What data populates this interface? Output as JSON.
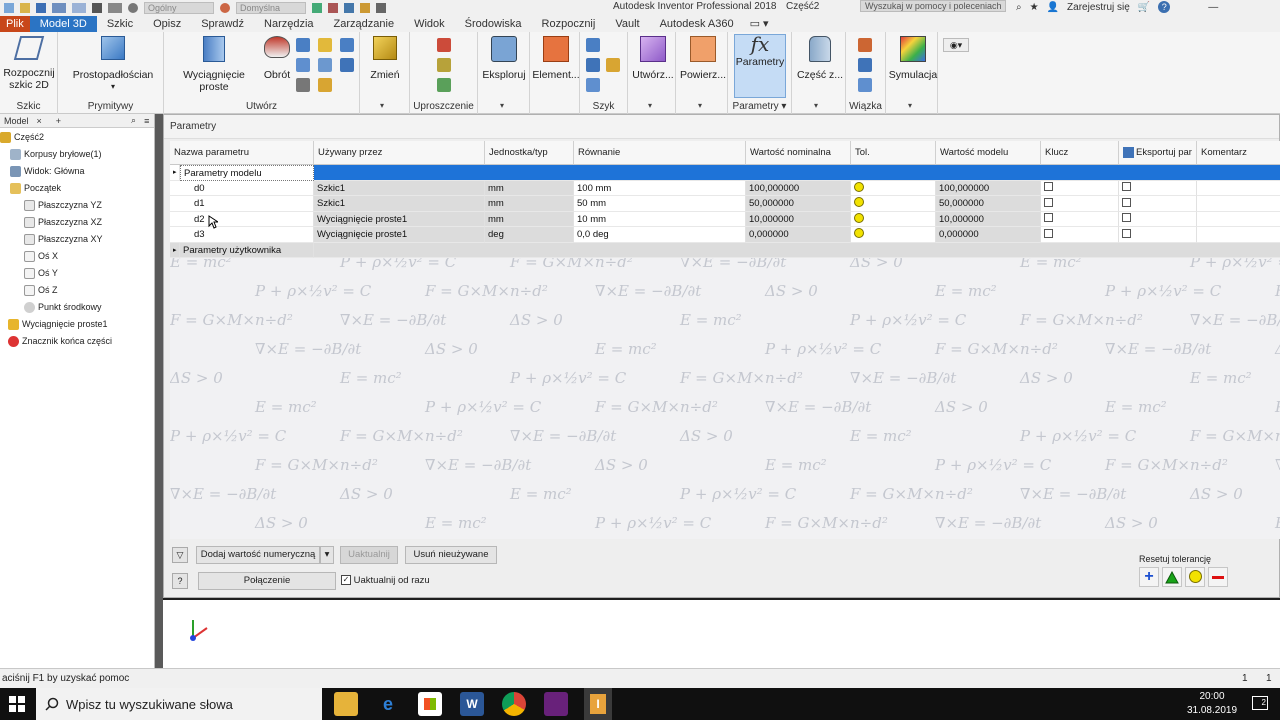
{
  "titlebar": {
    "dropdown1": "Ogólny",
    "dropdown2": "Domyślna",
    "app_title": "Autodesk Inventor Professional 2018",
    "doc_title": "Część2",
    "help_search": "Wyszukaj w pomocy i poleceniach",
    "signin": "Zarejestruj się"
  },
  "tabs": [
    "Plik",
    "Model 3D",
    "Szkic",
    "Opisz",
    "Sprawdź",
    "Narzędzia",
    "Zarządzanie",
    "Widok",
    "Środowiska",
    "Rozpocznij",
    "Vault",
    "Autodesk A360"
  ],
  "ribbon": {
    "sketch_btn": "Rozpocznij",
    "sketch_btn2": "szkic 2D",
    "panel_sketch": "Szkic",
    "box_btn": "Prostopadłościan",
    "panel_primitives": "Prymitywy",
    "extrude_btn": "Wyciągnięcie proste",
    "revolve_btn": "Obrót",
    "panel_create": "Utwórz",
    "modify_btn": "Zmień",
    "panel_simplify": "Uproszczenie",
    "explore_btn": "Eksploruj",
    "element_btn": "Element...",
    "panel_pattern": "Szyk",
    "create_btn": "Utwórz...",
    "surface_btn": "Powierz...",
    "params_btn": "Parametry",
    "panel_params": "Parametry",
    "part_btn": "Część z...",
    "panel_harness": "Wiązka",
    "sim_btn": "Symulacja"
  },
  "browser": {
    "tab_label": "Model",
    "items": [
      "Część2",
      "Korpusy bryłowe(1)",
      "Widok: Główna",
      "Początek",
      "Płaszczyzna YZ",
      "Płaszczyzna XZ",
      "Płaszczyzna XY",
      "Oś X",
      "Oś Y",
      "Oś Z",
      "Punkt środkowy",
      "Wyciągnięcie proste1",
      "Znacznik końca części"
    ]
  },
  "dialog": {
    "title": "Parametry",
    "columns": [
      "Nazwa parametru",
      "Używany przez",
      "Jednostka/typ",
      "Równanie",
      "Wartość nominalna",
      "Tol.",
      "Wartość modelu",
      "Klucz",
      "Eksportuj par",
      "Komentarz"
    ],
    "group_model": "Parametry modelu",
    "group_user": "Parametry użytkownika",
    "rows": [
      {
        "name": "d0",
        "used_by": "Szkic1",
        "unit": "mm",
        "equation": "100 mm",
        "nominal": "100,000000",
        "model": "100,000000"
      },
      {
        "name": "d1",
        "used_by": "Szkic1",
        "unit": "mm",
        "equation": "50 mm",
        "nominal": "50,000000",
        "model": "50,000000"
      },
      {
        "name": "d2",
        "used_by": "Wyciągnięcie proste1",
        "unit": "mm",
        "equation": "10 mm",
        "nominal": "10,000000",
        "model": "10,000000"
      },
      {
        "name": "d3",
        "used_by": "Wyciągnięcie proste1",
        "unit": "deg",
        "equation": "0,0 deg",
        "nominal": "0,000000",
        "model": "0,000000"
      }
    ],
    "add_numeric": "Dodaj wartość numeryczną",
    "update": "Uaktualnij",
    "purge": "Usuń nieużywane",
    "link": "Połączenie",
    "immediate_update": "Uaktualnij od razu",
    "reset_tol": "Resetuj tolerancję"
  },
  "statusbar": {
    "help": "aciśnij F1 by uzyskać pomoc",
    "num1": "1",
    "num2": "1"
  },
  "taskbar": {
    "search": "Wpisz tu wyszukiwane słowa",
    "time": "20:00",
    "date": "31.08.2019",
    "notif": "2"
  }
}
